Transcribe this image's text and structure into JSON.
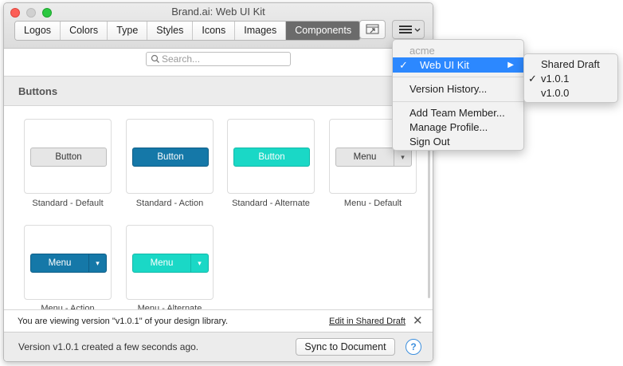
{
  "window": {
    "title": "Brand.ai: Web UI Kit"
  },
  "tabs": [
    "Logos",
    "Colors",
    "Type",
    "Styles",
    "Icons",
    "Images",
    "Components"
  ],
  "active_tab": "Components",
  "toolbar": {
    "share_icon": "window-share-icon",
    "menu_icon": "hamburger-menu-icon",
    "menu_caret": "▾"
  },
  "search": {
    "placeholder": "Search...",
    "icon": "search-icon"
  },
  "section": {
    "title": "Buttons"
  },
  "components": [
    {
      "label": "Standard - Default",
      "button_text": "Button"
    },
    {
      "label": "Standard - Action",
      "button_text": "Button"
    },
    {
      "label": "Standard - Alternate",
      "button_text": "Button"
    },
    {
      "label": "Menu - Default",
      "button_text": "Menu"
    },
    {
      "label": "Menu - Action",
      "button_text": "Menu"
    },
    {
      "label": "Menu - Alternate",
      "button_text": "Menu"
    }
  ],
  "notice": {
    "message": "You are viewing version \"v1.0.1\" of your design library.",
    "link": "Edit in Shared Draft",
    "close": "✕"
  },
  "status": {
    "text": "Version v1.0.1 created a few seconds ago.",
    "sync_button": "Sync to Document",
    "help": "?"
  },
  "menu": {
    "org": "acme",
    "library": "Web UI Kit",
    "library_check": "✓",
    "arrow": "▶",
    "version_history": "Version History...",
    "add_team_member": "Add Team Member...",
    "manage_profile": "Manage Profile...",
    "sign_out": "Sign Out"
  },
  "submenu": {
    "items": [
      "Shared Draft",
      "v1.0.1",
      "v1.0.0"
    ],
    "checked": "v1.0.1",
    "check": "✓"
  },
  "colors": {
    "action": "#1578a8",
    "alternate": "#1ad8c6",
    "menu_highlight": "#2c88ff"
  }
}
